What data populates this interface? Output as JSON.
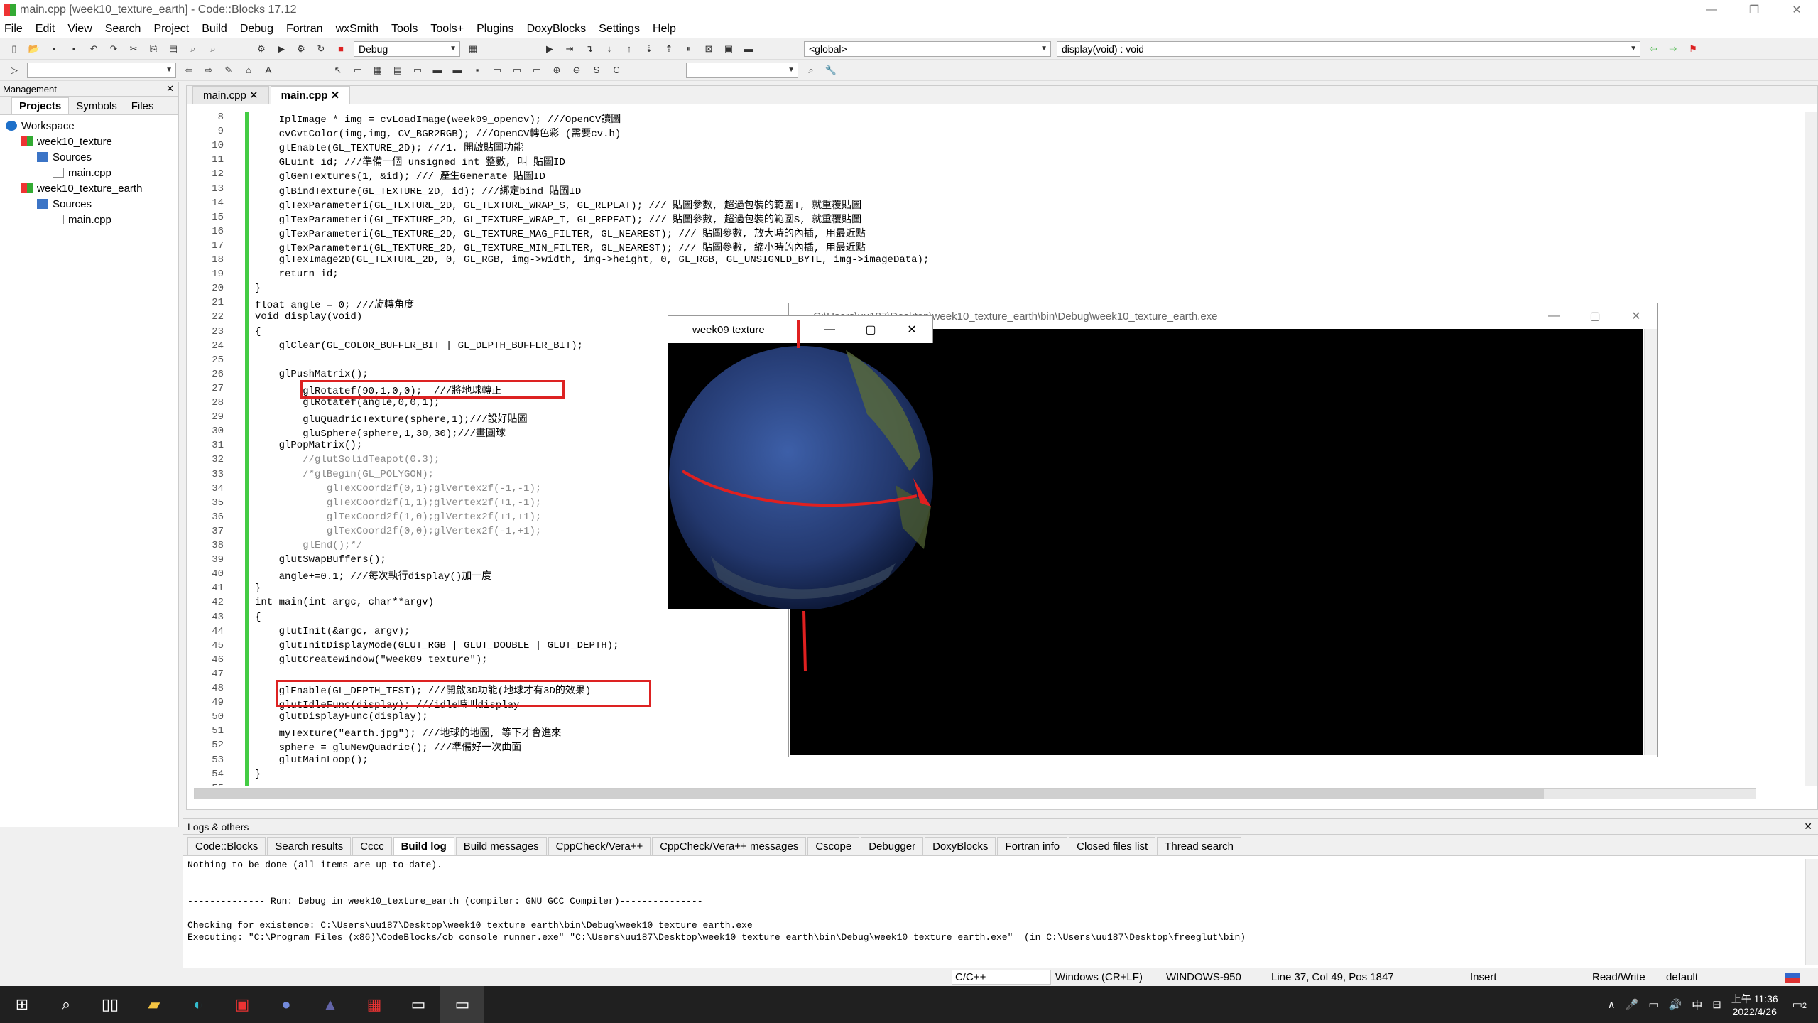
{
  "window": {
    "title": "main.cpp [week10_texture_earth] - Code::Blocks 17.12"
  },
  "menu": [
    "File",
    "Edit",
    "View",
    "Search",
    "Project",
    "Build",
    "Debug",
    "Fortran",
    "wxSmith",
    "Tools",
    "Tools+",
    "Plugins",
    "DoxyBlocks",
    "Settings",
    "Help"
  ],
  "toolbar": {
    "build_target": "Debug",
    "scope": "<global>",
    "function": "display(void) : void"
  },
  "management": {
    "title": "Management",
    "tabs": [
      "Projects",
      "Symbols",
      "Files"
    ],
    "tree": [
      {
        "label": "Workspace",
        "depth": 0
      },
      {
        "label": "week10_texture",
        "depth": 1
      },
      {
        "label": "Sources",
        "depth": 2
      },
      {
        "label": "main.cpp",
        "depth": 3
      },
      {
        "label": "week10_texture_earth",
        "depth": 1
      },
      {
        "label": "Sources",
        "depth": 2
      },
      {
        "label": "main.cpp",
        "depth": 3
      }
    ]
  },
  "editor": {
    "tabs": [
      "main.cpp",
      "main.cpp"
    ],
    "lines": [
      {
        "n": "8",
        "t": "    IplImage * img = cvLoadImage(week09_opencv); ///OpenCV讀圖"
      },
      {
        "n": "9",
        "t": "    cvCvtColor(img,img, CV_BGR2RGB); ///OpenCV轉色彩 (需要cv.h)"
      },
      {
        "n": "10",
        "t": "    glEnable(GL_TEXTURE_2D); ///1. 開啟貼圖功能"
      },
      {
        "n": "11",
        "t": "    GLuint id; ///準備一個 unsigned int 整數, 叫 貼圖ID"
      },
      {
        "n": "12",
        "t": "    glGenTextures(1, &id); /// 產生Generate 貼圖ID"
      },
      {
        "n": "13",
        "t": "    glBindTexture(GL_TEXTURE_2D, id); ///綁定bind 貼圖ID"
      },
      {
        "n": "14",
        "t": "    glTexParameteri(GL_TEXTURE_2D, GL_TEXTURE_WRAP_S, GL_REPEAT); /// 貼圖參數, 超過包裝的範圍T, 就重覆貼圖"
      },
      {
        "n": "15",
        "t": "    glTexParameteri(GL_TEXTURE_2D, GL_TEXTURE_WRAP_T, GL_REPEAT); /// 貼圖參數, 超過包裝的範圍S, 就重覆貼圖"
      },
      {
        "n": "16",
        "t": "    glTexParameteri(GL_TEXTURE_2D, GL_TEXTURE_MAG_FILTER, GL_NEAREST); /// 貼圖參數, 放大時的內插, 用最近點"
      },
      {
        "n": "17",
        "t": "    glTexParameteri(GL_TEXTURE_2D, GL_TEXTURE_MIN_FILTER, GL_NEAREST); /// 貼圖參數, 縮小時的內插, 用最近點"
      },
      {
        "n": "18",
        "t": "    glTexImage2D(GL_TEXTURE_2D, 0, GL_RGB, img->width, img->height, 0, GL_RGB, GL_UNSIGNED_BYTE, img->imageData);"
      },
      {
        "n": "19",
        "t": "    return id;"
      },
      {
        "n": "20",
        "t": "}"
      },
      {
        "n": "21",
        "t": "float angle = 0; ///旋轉角度"
      },
      {
        "n": "22",
        "t": "void display(void)"
      },
      {
        "n": "23",
        "t": "{"
      },
      {
        "n": "24",
        "t": "    glClear(GL_COLOR_BUFFER_BIT | GL_DEPTH_BUFFER_BIT);"
      },
      {
        "n": "25",
        "t": ""
      },
      {
        "n": "26",
        "t": "    glPushMatrix();"
      },
      {
        "n": "27",
        "t": "        glRotatef(90,1,0,0);  ///將地球轉正"
      },
      {
        "n": "28",
        "t": "        glRotatef(angle,0,0,1);"
      },
      {
        "n": "29",
        "t": "        gluQuadricTexture(sphere,1);///設好貼圖"
      },
      {
        "n": "30",
        "t": "        gluSphere(sphere,1,30,30);///畫圓球"
      },
      {
        "n": "31",
        "t": "    glPopMatrix();"
      },
      {
        "n": "32",
        "t": "        //glutSolidTeapot(0.3);"
      },
      {
        "n": "33",
        "t": "        /*glBegin(GL_POLYGON);"
      },
      {
        "n": "34",
        "t": "            glTexCoord2f(0,1);glVertex2f(-1,-1);"
      },
      {
        "n": "35",
        "t": "            glTexCoord2f(1,1);glVertex2f(+1,-1);"
      },
      {
        "n": "36",
        "t": "            glTexCoord2f(1,0);glVertex2f(+1,+1);"
      },
      {
        "n": "37",
        "t": "            glTexCoord2f(0,0);glVertex2f(-1,+1);"
      },
      {
        "n": "38",
        "t": "        glEnd();*/"
      },
      {
        "n": "39",
        "t": "    glutSwapBuffers();"
      },
      {
        "n": "40",
        "t": "    angle+=0.1; ///每次執行display()加一度"
      },
      {
        "n": "41",
        "t": "}"
      },
      {
        "n": "42",
        "t": "int main(int argc, char**argv)"
      },
      {
        "n": "43",
        "t": "{"
      },
      {
        "n": "44",
        "t": "    glutInit(&argc, argv);"
      },
      {
        "n": "45",
        "t": "    glutInitDisplayMode(GLUT_RGB | GLUT_DOUBLE | GLUT_DEPTH);"
      },
      {
        "n": "46",
        "t": "    glutCreateWindow(\"week09 texture\");"
      },
      {
        "n": "47",
        "t": ""
      },
      {
        "n": "48",
        "t": "    glEnable(GL_DEPTH_TEST); ///開啟3D功能(地球才有3D的效果)"
      },
      {
        "n": "49",
        "t": "    glutIdleFunc(display); ///idle時叫display"
      },
      {
        "n": "50",
        "t": "    glutDisplayFunc(display);"
      },
      {
        "n": "51",
        "t": "    myTexture(\"earth.jpg\"); ///地球的地圖, 等下才會進來"
      },
      {
        "n": "52",
        "t": "    sphere = gluNewQuadric(); ///準備好一次曲面"
      },
      {
        "n": "53",
        "t": "    glutMainLoop();"
      },
      {
        "n": "54",
        "t": "}"
      },
      {
        "n": "55",
        "t": ""
      }
    ]
  },
  "console_window": {
    "title": "C:\\Users\\uu187\\Desktop\\week10_texture_earth\\bin\\Debug\\week10_texture_earth.exe"
  },
  "glut_window": {
    "title": "week09 texture"
  },
  "logs": {
    "title": "Logs & others",
    "tabs": [
      "Code::Blocks",
      "Search results",
      "Cccc",
      "Build log",
      "Build messages",
      "CppCheck/Vera++",
      "CppCheck/Vera++ messages",
      "Cscope",
      "Debugger",
      "DoxyBlocks",
      "Fortran info",
      "Closed files list",
      "Thread search"
    ],
    "text": "Nothing to be done (all items are up-to-date).\n\n\n-------------- Run: Debug in week10_texture_earth (compiler: GNU GCC Compiler)---------------\n\nChecking for existence: C:\\Users\\uu187\\Desktop\\week10_texture_earth\\bin\\Debug\\week10_texture_earth.exe\nExecuting: \"C:\\Program Files (x86)\\CodeBlocks/cb_console_runner.exe\" \"C:\\Users\\uu187\\Desktop\\week10_texture_earth\\bin\\Debug\\week10_texture_earth.exe\"  (in C:\\Users\\uu187\\Desktop\\freeglut\\bin)"
  },
  "status": {
    "lang": "C/C++",
    "eol": "Windows (CR+LF)",
    "enc": "WINDOWS-950",
    "pos": "Line 37, Col 49, Pos 1847",
    "mode": "Insert",
    "rw": "Read/Write",
    "profile": "default"
  },
  "tray": {
    "ime": "中",
    "time": "上午 11:36",
    "date": "2022/4/26",
    "notif": "2"
  }
}
